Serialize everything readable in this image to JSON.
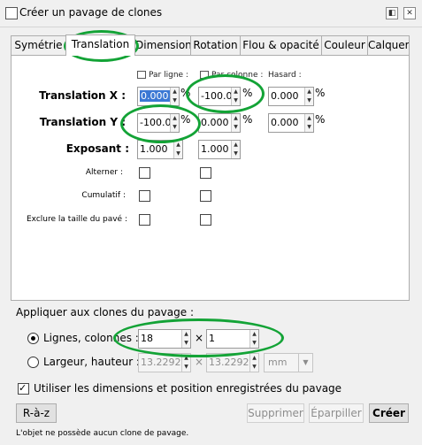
{
  "window": {
    "title": "Créer un pavage de clones",
    "btn_detach": "◧",
    "btn_close": "✕"
  },
  "tabs": [
    "Symétrie",
    "Translation",
    "Dimensions",
    "Rotation",
    "Flou & opacité",
    "Couleur",
    "Calquer"
  ],
  "columns": {
    "per_row": "Par ligne :",
    "per_col": "Par colonne :",
    "random": "Hasard :"
  },
  "rows": {
    "tx": {
      "label": "Translation X :",
      "row": "0.000",
      "col": "-100.0",
      "rand": "0.000",
      "unit": "%"
    },
    "ty": {
      "label": "Translation Y :",
      "row": "-100.0",
      "col": "0.000",
      "rand": "0.000",
      "unit": "%"
    },
    "exp": {
      "label": "Exposant :",
      "row": "1.000",
      "col": "1.000"
    },
    "alternate": "Alterner :",
    "cumulative": "Cumulatif :",
    "exclude": "Exclure la taille du pavé :"
  },
  "apply": {
    "title": "Appliquer aux clones du pavage :",
    "rows_cols_label": "Lignes, colonnes :",
    "rows": "18",
    "cols": "1",
    "times": "×",
    "wh_label": "Largeur, hauteur :",
    "width": "13.2292",
    "height": "13.2292",
    "unit": "mm"
  },
  "use_saved": "Utiliser les dimensions et position enregistrées du pavage",
  "buttons": {
    "reset": "R-à-z",
    "remove": "Supprimer",
    "unclump": "Éparpiller",
    "create": "Créer"
  },
  "status": "L'objet ne possède aucun clone de pavage.",
  "colors": {
    "annotation": "#13a336",
    "selection": "#3b78d4"
  }
}
